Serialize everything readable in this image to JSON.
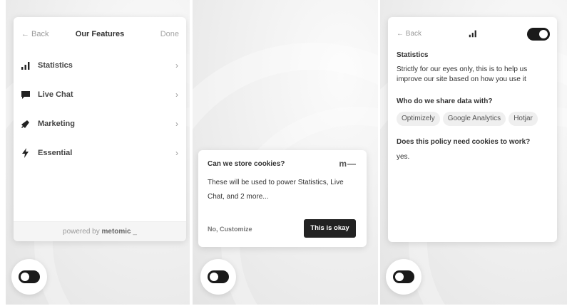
{
  "features_screen": {
    "back": "← Back",
    "title": "Our Features",
    "done": "Done",
    "items": [
      {
        "label": "Statistics",
        "icon": "bar-chart-icon"
      },
      {
        "label": "Live Chat",
        "icon": "chat-bubble-icon"
      },
      {
        "label": "Marketing",
        "icon": "megaphone-icon"
      },
      {
        "label": "Essential",
        "icon": "lightning-icon"
      }
    ],
    "chevron": "›",
    "footer_prefix": "powered by",
    "footer_brand": "metomic"
  },
  "cookie_banner": {
    "title": "Can we store cookies?",
    "logo": "m—",
    "body": "These will be used to power Statistics, Live Chat, and 2 more...",
    "customize": "No, Customize",
    "accept": "This is okay"
  },
  "detail_screen": {
    "back": "← Back",
    "heading": "Statistics",
    "description": "Strictly for our eyes only, this is to help us improve our site based on how you use it",
    "share_heading": "Who do we share data with?",
    "partners": [
      "Optimizely",
      "Google Analytics",
      "Hotjar"
    ],
    "policy_question": "Does this policy need cookies to work?",
    "policy_answer": "yes.",
    "enabled": true
  },
  "colors": {
    "dark": "#1a1a1a",
    "tag_bg": "#efefef",
    "muted": "#9a9a9a"
  }
}
